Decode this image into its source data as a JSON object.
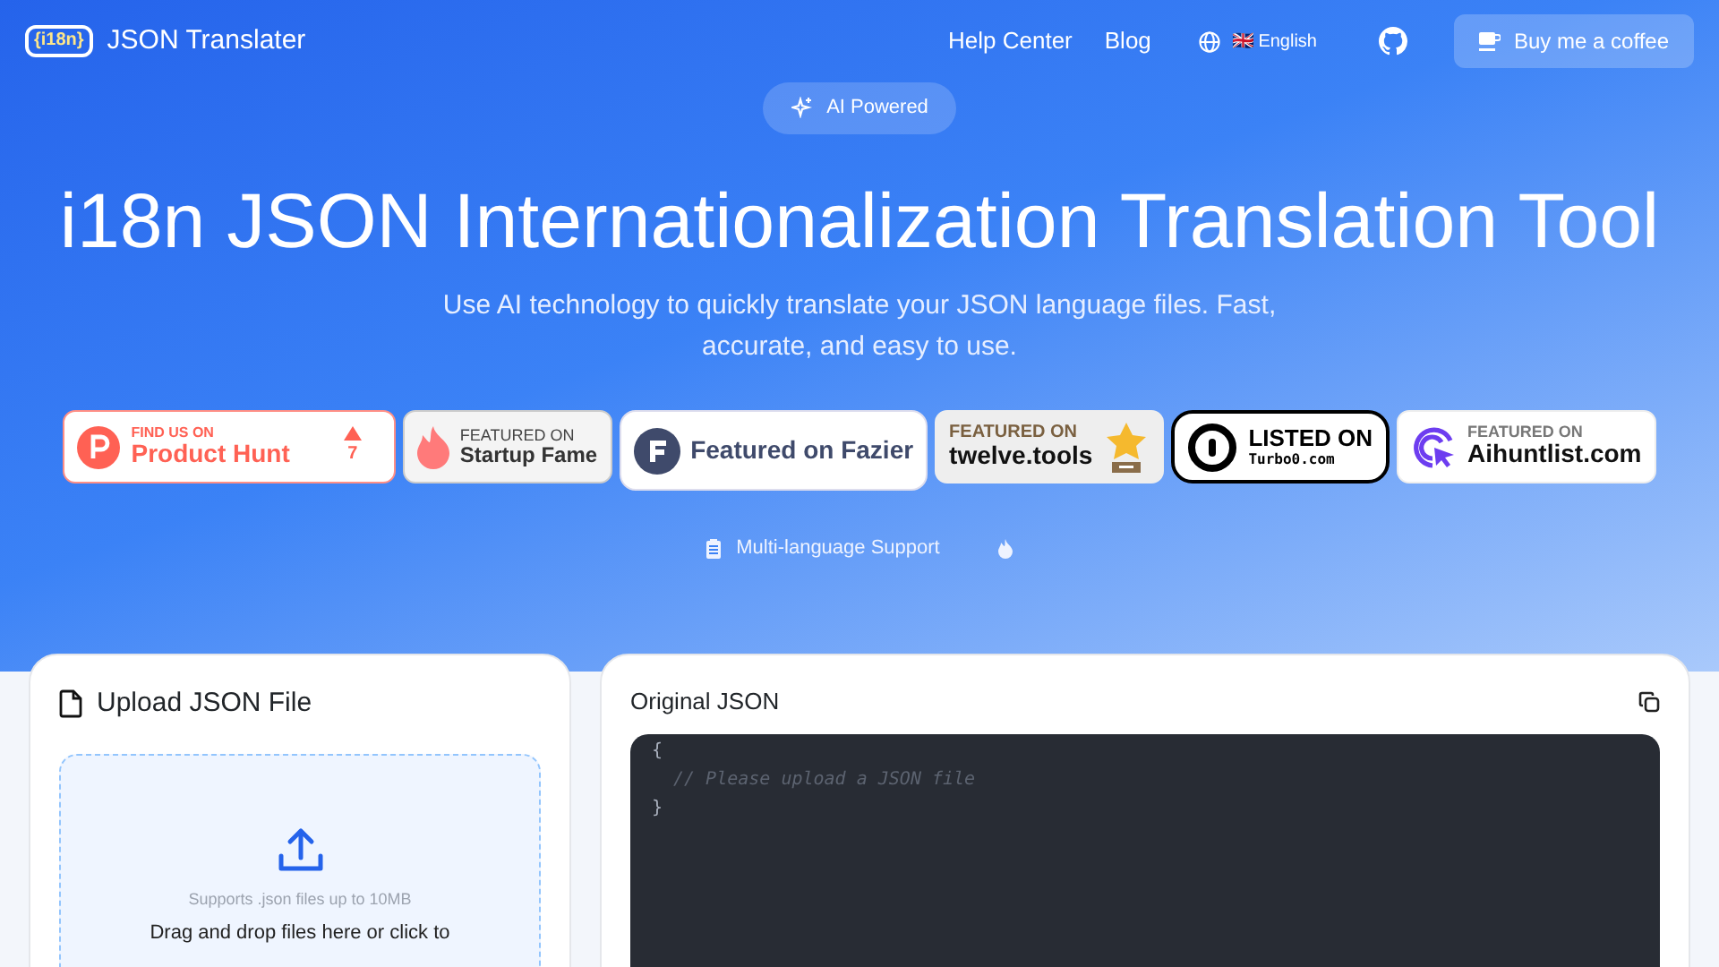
{
  "header": {
    "logo_text": "{i18n}",
    "brand": "JSON Translater",
    "nav_links": [
      "Help Center",
      "Blog"
    ],
    "language": {
      "flag": "🇬🇧",
      "label": "English"
    },
    "coffee_button": "Buy me a coffee"
  },
  "hero": {
    "pill": "AI Powered",
    "title": "i18n JSON Internationalization Translation Tool",
    "subtitle": "Use AI technology to quickly translate your JSON language files. Fast, accurate, and easy to use.",
    "badges": [
      {
        "kind": "producthunt",
        "top": "FIND US ON",
        "main": "Product Hunt",
        "count": "7"
      },
      {
        "kind": "startupfame",
        "top": "FEATURED ON",
        "main": "Startup Fame"
      },
      {
        "kind": "fazier",
        "main": "Featured on Fazier"
      },
      {
        "kind": "twelve",
        "top": "FEATURED ON",
        "main": "twelve.tools"
      },
      {
        "kind": "turbo",
        "top": "LISTED ON",
        "main": "Turbo0.com"
      },
      {
        "kind": "aihunt",
        "top": "FEATURED ON",
        "main": "Aihuntlist.com"
      }
    ],
    "feature": "Multi-language Support"
  },
  "upload_card": {
    "title": "Upload JSON File",
    "hint": "Supports .json files up to 10MB",
    "instruction": "Drag and drop files here or click to"
  },
  "original_card": {
    "title": "Original JSON",
    "code_lines": [
      {
        "kind": "brace",
        "text": "{"
      },
      {
        "kind": "comment",
        "text": "// Please upload a JSON file"
      },
      {
        "kind": "brace",
        "text": "}"
      }
    ]
  }
}
